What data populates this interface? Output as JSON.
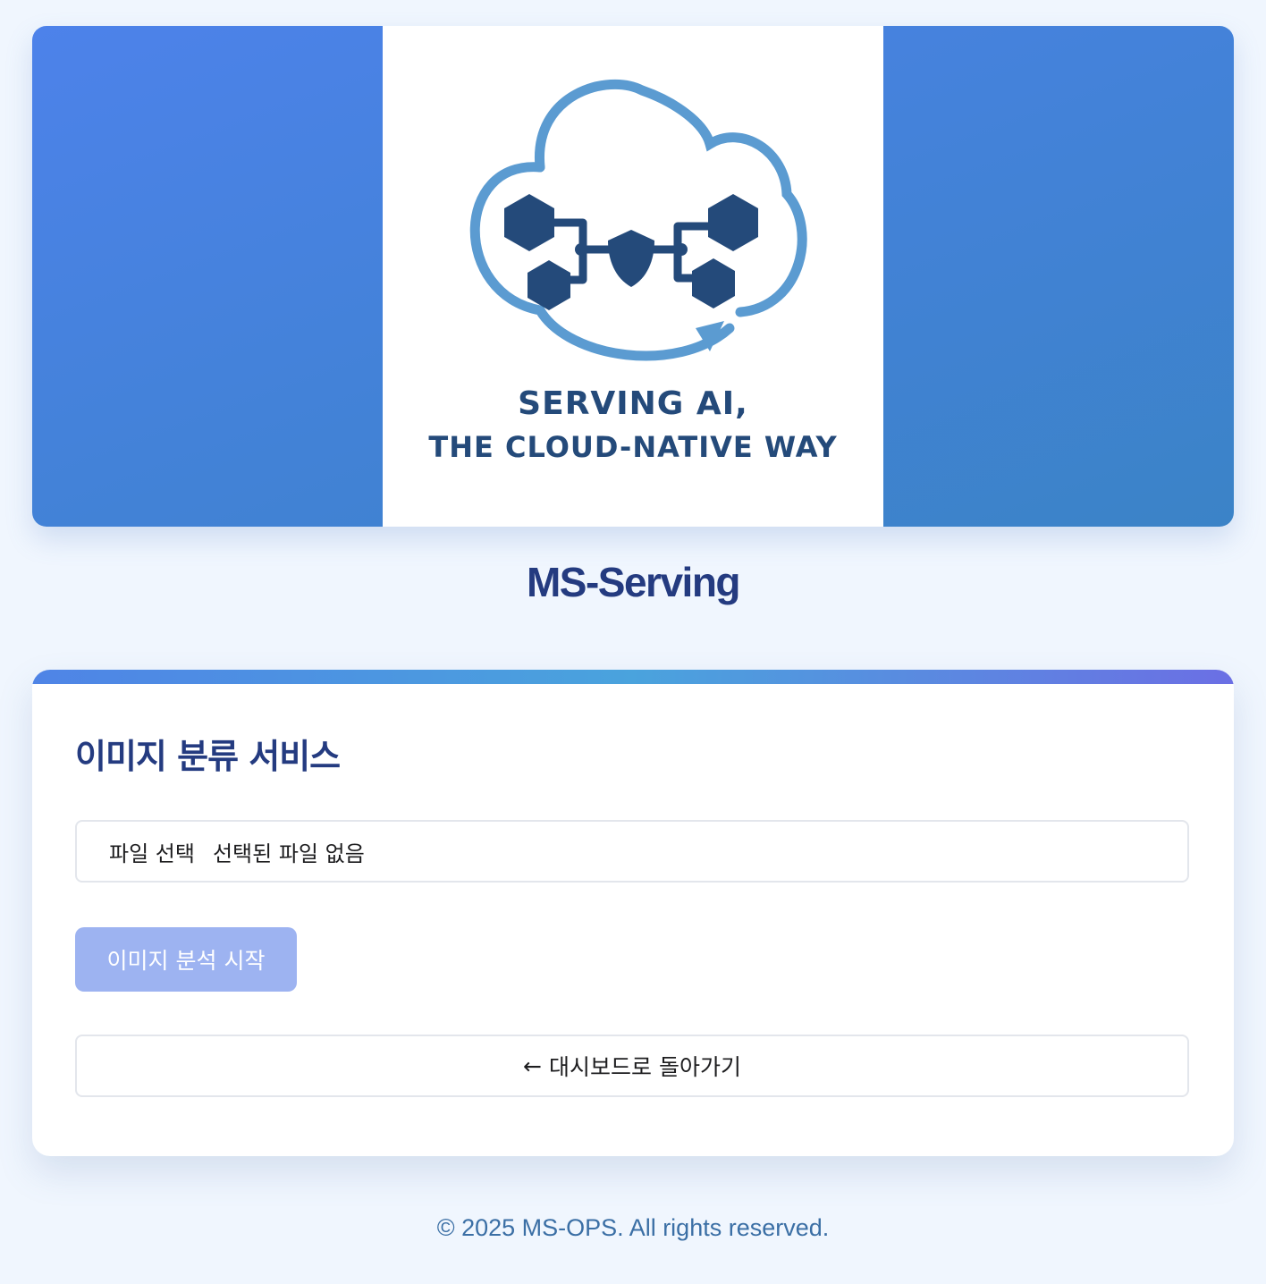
{
  "hero": {
    "logo": {
      "tagline_line1": "SERVING AI,",
      "tagline_line2": "THE CLOUD-NATIVE WAY",
      "icon": "cloud-network-icon"
    }
  },
  "page": {
    "title": "MS-Serving"
  },
  "card": {
    "title": "이미지 분류 서비스",
    "file_input": {
      "button_label": "파일 선택",
      "status_text": "선택된 파일 없음"
    },
    "analyze_button_label": "이미지 분석 시작",
    "back_button": {
      "arrow": "←",
      "label": "대시보드로 돌아가기"
    }
  },
  "footer": {
    "text": "© 2025 MS-OPS. All rights reserved."
  },
  "colors": {
    "background": "#f0f6fe",
    "hero_gradient_start": "#4d82ea",
    "hero_gradient_end": "#3b83c7",
    "title": "#243b80",
    "logo_navy": "#244a7a",
    "logo_light_blue": "#5b9bd1",
    "button_disabled": "#9db3f1",
    "footer_text": "#3b6fa5"
  }
}
